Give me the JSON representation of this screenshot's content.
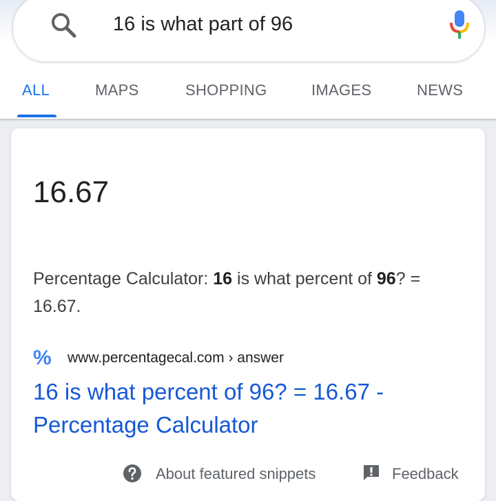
{
  "search": {
    "query": "16 is what part of 96",
    "search_icon": "search-icon",
    "mic_icon": "mic-icon"
  },
  "tabs": [
    {
      "label": "ALL",
      "active": true
    },
    {
      "label": "MAPS",
      "active": false
    },
    {
      "label": "SHOPPING",
      "active": false
    },
    {
      "label": "IMAGES",
      "active": false
    },
    {
      "label": "NEWS",
      "active": false
    }
  ],
  "snippet": {
    "answer": "16.67",
    "text_parts": [
      "Percentage Calculator: ",
      "16",
      " is what percent of ",
      "96",
      "? = 16.67."
    ],
    "favicon": "%",
    "site_url": "www.percentagecal.com › answer",
    "result_title": "16 is what percent of 96? = 16.67 - Percentage Calculator"
  },
  "footer": {
    "about_label": "About featured snippets",
    "feedback_label": "Feedback",
    "about_icon": "help-circle-icon",
    "feedback_icon": "feedback-icon"
  },
  "colors": {
    "accent": "#1a73e8",
    "link": "#1558d6",
    "mic_blue": "#4285f4",
    "mic_red": "#ea4335",
    "mic_yellow": "#fbbc05",
    "mic_green": "#34a853"
  }
}
